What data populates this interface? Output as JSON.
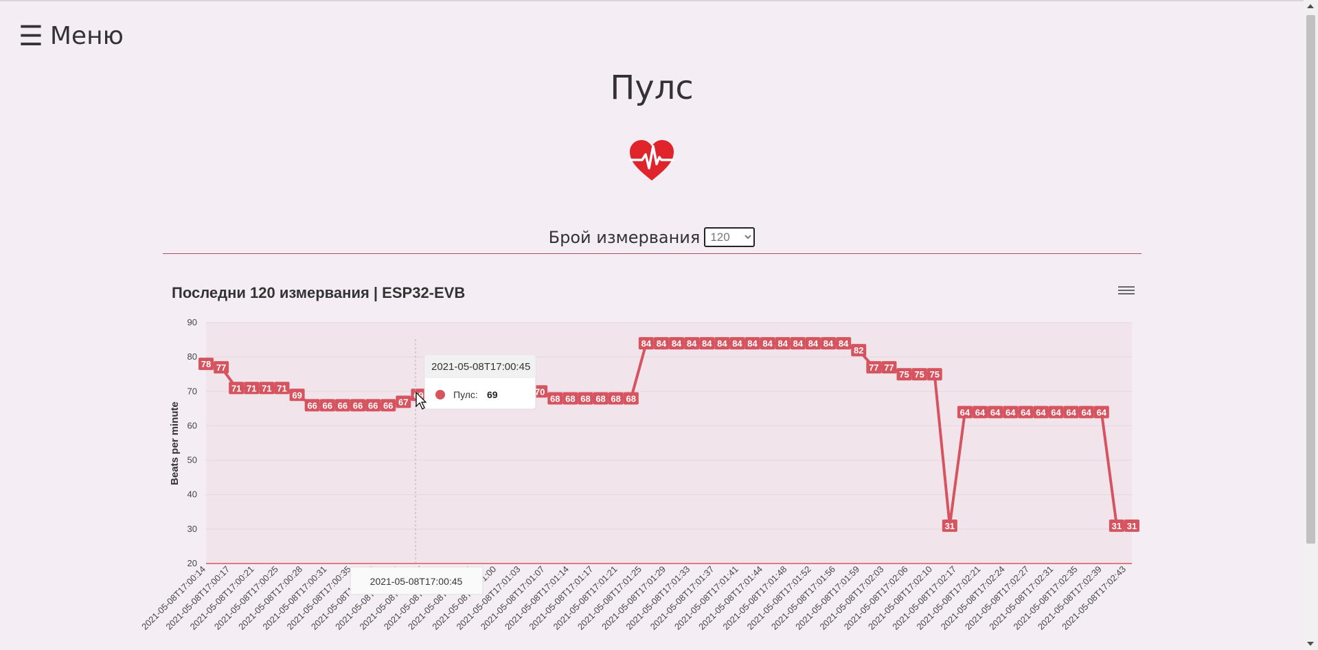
{
  "menu": {
    "icon": "hamburger-icon",
    "label": "Меню"
  },
  "page_title": "Пулс",
  "heart_icon": "heart-pulse-icon",
  "measurement_count": {
    "label": "Брой измервания",
    "selected": "120",
    "options": [
      "120"
    ]
  },
  "colors": {
    "series": "#d5545f",
    "background": "#f4eef4",
    "divider": "#b04858"
  },
  "chart_menu_icon": "chart-context-menu-icon",
  "tooltip": {
    "time": "2021-05-08T17:00:45",
    "series_name": "Пулс",
    "separator": ":",
    "value": "69"
  },
  "crosshair_label": "2021-05-08T17:00:45",
  "chart_data": {
    "type": "line",
    "title": "Последни 120 измервания | ESP32-EVB",
    "ylabel": "Beats per minute",
    "xlabel": "",
    "ylim": [
      20,
      90
    ],
    "yticks": [
      20,
      30,
      40,
      50,
      60,
      70,
      80,
      90
    ],
    "grid": true,
    "x_ticks": [
      "2021-05-08T17:00:14",
      "2021-05-08T17:00:17",
      "2021-05-08T17:00:21",
      "2021-05-08T17:00:25",
      "2021-05-08T17:00:28",
      "2021-05-08T17:00:31",
      "2021-05-08T17:00:35",
      "2021-05-08T17:00:38",
      "2021-05-08T17:00:42",
      "2021-05-08T17:00:45",
      "2021-05-08T17:00:49",
      "2021-05-08T17:00:56",
      "2021-05-08T17:01:00",
      "2021-05-08T17:01:03",
      "2021-05-08T17:01:07",
      "2021-05-08T17:01:14",
      "2021-05-08T17:01:17",
      "2021-05-08T17:01:21",
      "2021-05-08T17:01:25",
      "2021-05-08T17:01:29",
      "2021-05-08T17:01:33",
      "2021-05-08T17:01:37",
      "2021-05-08T17:01:41",
      "2021-05-08T17:01:44",
      "2021-05-08T17:01:48",
      "2021-05-08T17:01:52",
      "2021-05-08T17:01:56",
      "2021-05-08T17:01:59",
      "2021-05-08T17:02:03",
      "2021-05-08T17:02:06",
      "2021-05-08T17:02:10",
      "2021-05-08T17:02:17",
      "2021-05-08T17:02:21",
      "2021-05-08T17:02:24",
      "2021-05-08T17:02:27",
      "2021-05-08T17:02:31",
      "2021-05-08T17:02:35",
      "2021-05-08T17:02:39",
      "2021-05-08T17:02:43"
    ],
    "series": [
      {
        "name": "Пулс",
        "values": [
          78,
          77,
          71,
          71,
          71,
          71,
          69,
          66,
          66,
          66,
          66,
          66,
          66,
          67,
          69,
          69,
          69,
          69,
          69,
          69,
          69,
          69,
          70,
          68,
          68,
          68,
          68,
          68,
          68,
          84,
          84,
          84,
          84,
          84,
          84,
          84,
          84,
          84,
          84,
          84,
          84,
          84,
          84,
          82,
          77,
          77,
          75,
          75,
          75,
          31,
          64,
          64,
          64,
          64,
          64,
          64,
          64,
          64,
          64,
          64,
          31,
          31
        ]
      }
    ]
  }
}
